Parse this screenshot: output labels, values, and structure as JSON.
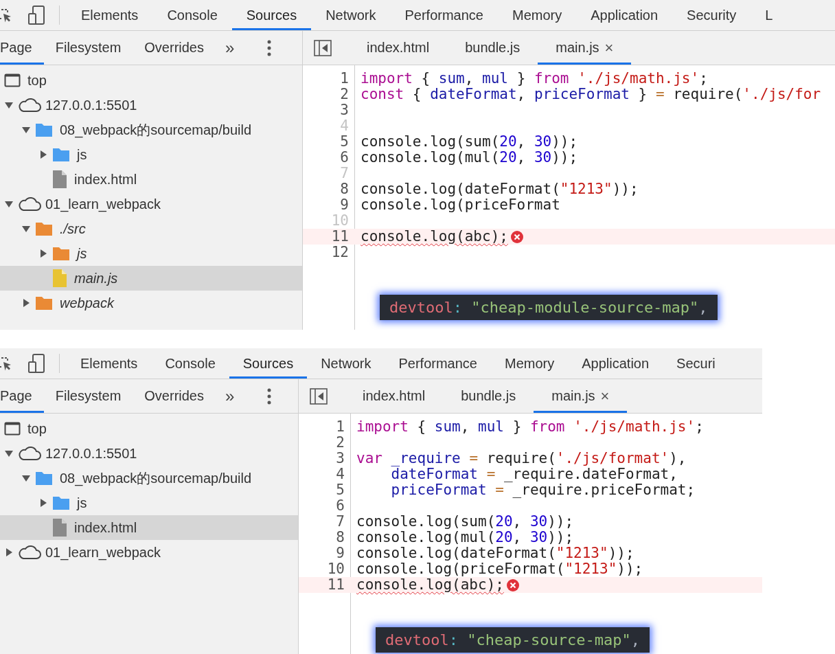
{
  "panels": [
    {
      "toolbar_tabs": [
        {
          "label": "Elements",
          "selected": false
        },
        {
          "label": "Console",
          "selected": false
        },
        {
          "label": "Sources",
          "selected": true
        },
        {
          "label": "Network",
          "selected": false
        },
        {
          "label": "Performance",
          "selected": false
        },
        {
          "label": "Memory",
          "selected": false
        },
        {
          "label": "Application",
          "selected": false
        },
        {
          "label": "Security",
          "selected": false
        },
        {
          "label": "L",
          "selected": false
        }
      ],
      "navigator_tabs": [
        {
          "label": "Page",
          "selected": true
        },
        {
          "label": "Filesystem",
          "selected": false
        },
        {
          "label": "Overrides",
          "selected": false
        }
      ],
      "more_tabs": "»",
      "tree": [
        {
          "label": "top",
          "kind": "frame",
          "selected": false,
          "source_mapped": false
        },
        {
          "label": "127.0.0.1:5501",
          "kind": "origin",
          "expanded": true,
          "selected": false,
          "source_mapped": false,
          "children": [
            {
              "label": "08_webpack的sourcemap/build",
              "kind": "folder",
              "color": "#4a9ff0",
              "expanded": true,
              "selected": false,
              "source_mapped": false,
              "children": [
                {
                  "label": "js",
                  "kind": "folder",
                  "color": "#4a9ff0",
                  "expanded": false,
                  "selected": false,
                  "source_mapped": false
                },
                {
                  "label": "index.html",
                  "kind": "file",
                  "color": "#8a8a8a",
                  "selected": false,
                  "source_mapped": false
                }
              ]
            }
          ]
        },
        {
          "label": "01_learn_webpack",
          "kind": "origin",
          "expanded": true,
          "selected": false,
          "source_mapped": false,
          "children": [
            {
              "label": "./src",
              "kind": "folder",
              "color": "#ea8a35",
              "expanded": true,
              "selected": false,
              "source_mapped": true,
              "children": [
                {
                  "label": "js",
                  "kind": "folder",
                  "color": "#ea8a35",
                  "expanded": false,
                  "selected": false,
                  "source_mapped": true
                },
                {
                  "label": "main.js",
                  "kind": "file",
                  "color": "#e8c333",
                  "selected": true,
                  "source_mapped": true
                }
              ]
            },
            {
              "label": "webpack",
              "kind": "folder",
              "color": "#ea8a35",
              "expanded": false,
              "selected": false,
              "source_mapped": true
            }
          ]
        }
      ],
      "editor_tabs": [
        {
          "label": "index.html",
          "selected": false
        },
        {
          "label": "bundle.js",
          "selected": false
        },
        {
          "label": "main.js",
          "selected": true,
          "close": "×"
        }
      ],
      "lines": [
        {
          "n": "1",
          "mapped": true,
          "error": false,
          "tokens": [
            {
              "t": "import ",
              "kind": "keyword"
            },
            {
              "t": "{ ",
              "kind": "plain"
            },
            {
              "t": "sum",
              "kind": "def"
            },
            {
              "t": ", ",
              "kind": "plain"
            },
            {
              "t": "mul",
              "kind": "def"
            },
            {
              "t": " } ",
              "kind": "plain"
            },
            {
              "t": "from ",
              "kind": "keyword"
            },
            {
              "t": "'./js/math.js'",
              "kind": "string"
            },
            {
              "t": ";",
              "kind": "plain"
            }
          ]
        },
        {
          "n": "2",
          "mapped": true,
          "error": false,
          "tokens": [
            {
              "t": "const",
              "kind": "keyword"
            },
            {
              "t": " { ",
              "kind": "plain"
            },
            {
              "t": "dateFormat",
              "kind": "def"
            },
            {
              "t": ", ",
              "kind": "plain"
            },
            {
              "t": "priceFormat",
              "kind": "def"
            },
            {
              "t": " } ",
              "kind": "plain"
            },
            {
              "t": "=",
              "kind": "operator"
            },
            {
              "t": " require(",
              "kind": "plain"
            },
            {
              "t": "'./js/for",
              "kind": "string"
            }
          ]
        },
        {
          "n": "3",
          "mapped": true,
          "error": false
        },
        {
          "n": "4",
          "mapped": false,
          "error": false
        },
        {
          "n": "5",
          "mapped": true,
          "error": false,
          "tokens": [
            {
              "t": "console.log(sum(",
              "kind": "plain"
            },
            {
              "t": "20",
              "kind": "number"
            },
            {
              "t": ", ",
              "kind": "plain"
            },
            {
              "t": "30",
              "kind": "number"
            },
            {
              "t": "));",
              "kind": "plain"
            }
          ]
        },
        {
          "n": "6",
          "mapped": true,
          "error": false,
          "tokens": [
            {
              "t": "console.log(mul(",
              "kind": "plain"
            },
            {
              "t": "20",
              "kind": "number"
            },
            {
              "t": ", ",
              "kind": "plain"
            },
            {
              "t": "30",
              "kind": "number"
            },
            {
              "t": "));",
              "kind": "plain"
            }
          ]
        },
        {
          "n": "7",
          "mapped": false,
          "error": false
        },
        {
          "n": "8",
          "mapped": true,
          "error": false,
          "tokens": [
            {
              "t": "console.log(dateFormat(",
              "kind": "plain"
            },
            {
              "t": "\"1213\"",
              "kind": "string"
            },
            {
              "t": "));",
              "kind": "plain"
            }
          ]
        },
        {
          "n": "9",
          "mapped": true,
          "error": false,
          "tokens": [
            {
              "t": "console.log(priceFormat",
              "kind": "plain"
            }
          ]
        },
        {
          "n": "10",
          "mapped": false,
          "error": false
        },
        {
          "n": "11",
          "mapped": true,
          "error": true,
          "tokens": [
            {
              "t": "console.log(abc);",
              "kind": "plain"
            }
          ]
        },
        {
          "n": "12",
          "mapped": true,
          "error": false
        }
      ],
      "callout": {
        "key": "devtool",
        "sep": ":",
        "value": "\"cheap-module-source-map\"",
        "trail": ","
      }
    },
    {
      "toolbar_tabs": [
        {
          "label": "Elements",
          "selected": false
        },
        {
          "label": "Console",
          "selected": false
        },
        {
          "label": "Sources",
          "selected": true
        },
        {
          "label": "Network",
          "selected": false
        },
        {
          "label": "Performance",
          "selected": false
        },
        {
          "label": "Memory",
          "selected": false
        },
        {
          "label": "Application",
          "selected": false
        },
        {
          "label": "Securi",
          "selected": false
        }
      ],
      "navigator_tabs": [
        {
          "label": "Page",
          "selected": true
        },
        {
          "label": "Filesystem",
          "selected": false
        },
        {
          "label": "Overrides",
          "selected": false
        }
      ],
      "more_tabs": "»",
      "tree": [
        {
          "label": "top",
          "kind": "frame",
          "selected": false,
          "source_mapped": false
        },
        {
          "label": "127.0.0.1:5501",
          "kind": "origin",
          "expanded": true,
          "selected": false,
          "source_mapped": false,
          "children": [
            {
              "label": "08_webpack的sourcemap/build",
              "kind": "folder",
              "color": "#4a9ff0",
              "expanded": true,
              "selected": false,
              "source_mapped": false,
              "children": [
                {
                  "label": "js",
                  "kind": "folder",
                  "color": "#4a9ff0",
                  "expanded": false,
                  "selected": false,
                  "source_mapped": false
                },
                {
                  "label": "index.html",
                  "kind": "file",
                  "color": "#8a8a8a",
                  "selected": true,
                  "source_mapped": false
                }
              ]
            }
          ]
        },
        {
          "label": "01_learn_webpack",
          "kind": "origin",
          "expanded": false,
          "selected": false,
          "source_mapped": false
        }
      ],
      "editor_tabs": [
        {
          "label": "index.html",
          "selected": false
        },
        {
          "label": "bundle.js",
          "selected": false
        },
        {
          "label": "main.js",
          "selected": true,
          "close": "×"
        }
      ],
      "lines": [
        {
          "n": "1",
          "mapped": true,
          "error": false,
          "tokens": [
            {
              "t": "import ",
              "kind": "keyword"
            },
            {
              "t": "{ ",
              "kind": "plain"
            },
            {
              "t": "sum",
              "kind": "def"
            },
            {
              "t": ", ",
              "kind": "plain"
            },
            {
              "t": "mul",
              "kind": "def"
            },
            {
              "t": " } ",
              "kind": "plain"
            },
            {
              "t": "from ",
              "kind": "keyword"
            },
            {
              "t": "'./js/math.js'",
              "kind": "string"
            },
            {
              "t": ";",
              "kind": "plain"
            }
          ]
        },
        {
          "n": "2",
          "mapped": true,
          "error": false
        },
        {
          "n": "3",
          "mapped": true,
          "error": false,
          "tokens": [
            {
              "t": "var ",
              "kind": "keyword"
            },
            {
              "t": "_require ",
              "kind": "def"
            },
            {
              "t": "=",
              "kind": "operator"
            },
            {
              "t": " require(",
              "kind": "plain"
            },
            {
              "t": "'./js/format'",
              "kind": "string"
            },
            {
              "t": "),",
              "kind": "plain"
            }
          ]
        },
        {
          "n": "4",
          "mapped": true,
          "error": false,
          "tokens": [
            {
              "t": "    dateFormat ",
              "kind": "def"
            },
            {
              "t": "=",
              "kind": "operator"
            },
            {
              "t": " _require.dateFormat,",
              "kind": "plain"
            }
          ]
        },
        {
          "n": "5",
          "mapped": true,
          "error": false,
          "tokens": [
            {
              "t": "    priceFormat ",
              "kind": "def"
            },
            {
              "t": "=",
              "kind": "operator"
            },
            {
              "t": " _require.priceFormat;",
              "kind": "plain"
            }
          ]
        },
        {
          "n": "6",
          "mapped": true,
          "error": false
        },
        {
          "n": "7",
          "mapped": true,
          "error": false,
          "tokens": [
            {
              "t": "console.log(sum(",
              "kind": "plain"
            },
            {
              "t": "20",
              "kind": "number"
            },
            {
              "t": ", ",
              "kind": "plain"
            },
            {
              "t": "30",
              "kind": "number"
            },
            {
              "t": "));",
              "kind": "plain"
            }
          ]
        },
        {
          "n": "8",
          "mapped": true,
          "error": false,
          "tokens": [
            {
              "t": "console.log(mul(",
              "kind": "plain"
            },
            {
              "t": "20",
              "kind": "number"
            },
            {
              "t": ", ",
              "kind": "plain"
            },
            {
              "t": "30",
              "kind": "number"
            },
            {
              "t": "));",
              "kind": "plain"
            }
          ]
        },
        {
          "n": "9",
          "mapped": true,
          "error": false,
          "tokens": [
            {
              "t": "console.log(dateFormat(",
              "kind": "plain"
            },
            {
              "t": "\"1213\"",
              "kind": "string"
            },
            {
              "t": "));",
              "kind": "plain"
            }
          ]
        },
        {
          "n": "10",
          "mapped": true,
          "error": false,
          "tokens": [
            {
              "t": "console.log(priceFormat(",
              "kind": "plain"
            },
            {
              "t": "\"1213\"",
              "kind": "string"
            },
            {
              "t": "));",
              "kind": "plain"
            }
          ]
        },
        {
          "n": "11",
          "mapped": true,
          "error": true,
          "tokens": [
            {
              "t": "console.log(abc);",
              "kind": "plain"
            }
          ]
        }
      ],
      "callout": {
        "key": "devtool",
        "sep": ":",
        "value": "\"cheap-source-map\"",
        "trail": ","
      }
    }
  ]
}
